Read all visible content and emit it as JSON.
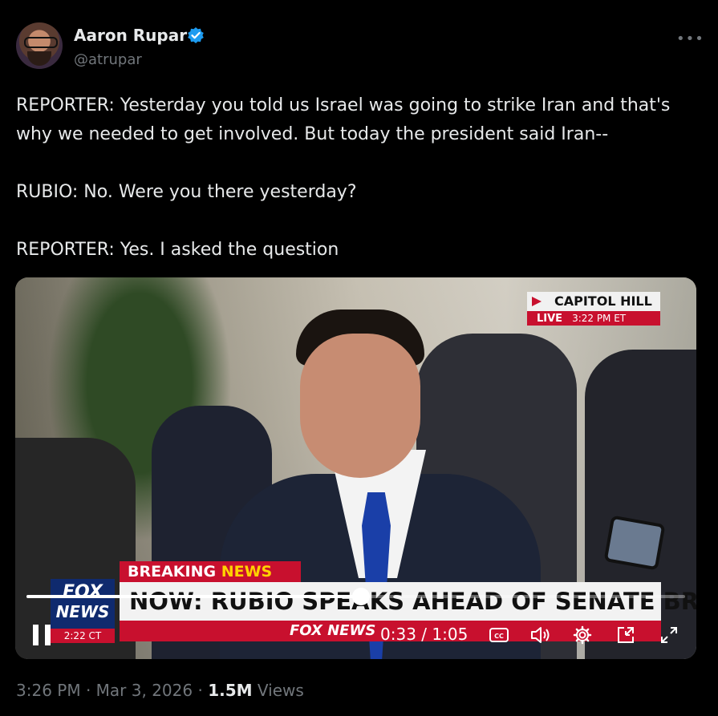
{
  "author": {
    "name": "Aaron Rupar",
    "handle": "@atrupar",
    "verified": true
  },
  "more_icon": "•••",
  "tweet_text": [
    "REPORTER: Yesterday you told us Israel was going to strike Iran and that's why we needed to get involved. But today the president said Iran--",
    "RUBIO: No. Were you there yesterday?",
    "REPORTER: Yes. I asked the question"
  ],
  "video": {
    "location_banner": "CAPITOL HILL",
    "live_label": "LIVE",
    "live_time": "3:22 PM ET",
    "breaking_label_1": "BREAKING",
    "breaking_label_2": "NEWS",
    "headline": "NOW: RUBIO SPEAKS AHEAD OF SENATE BRIEFING",
    "network_logo_1": "FOX",
    "network_logo_2": "NEWS",
    "network_time": "2:22 CT",
    "ticker_logo": "FOX NEWS",
    "current_time": "0:33",
    "duration": "1:05",
    "progress": 0.508,
    "icons": {
      "play_state": "pause-icon",
      "captions": "closed-captions-icon",
      "volume": "volume-icon",
      "settings": "gear-icon",
      "pip": "picture-in-picture-icon",
      "fullscreen": "fullscreen-icon"
    }
  },
  "meta": {
    "time": "3:26 PM",
    "date": "Mar 3, 2026",
    "views_count": "1.5M",
    "views_label": "Views",
    "separator": "·"
  },
  "colors": {
    "background": "#000000",
    "text": "#e7e9ea",
    "secondary_text": "#71767b",
    "verified": "#1d9bf0",
    "fox_red": "#c8102e",
    "fox_blue": "#0f2a6e"
  }
}
